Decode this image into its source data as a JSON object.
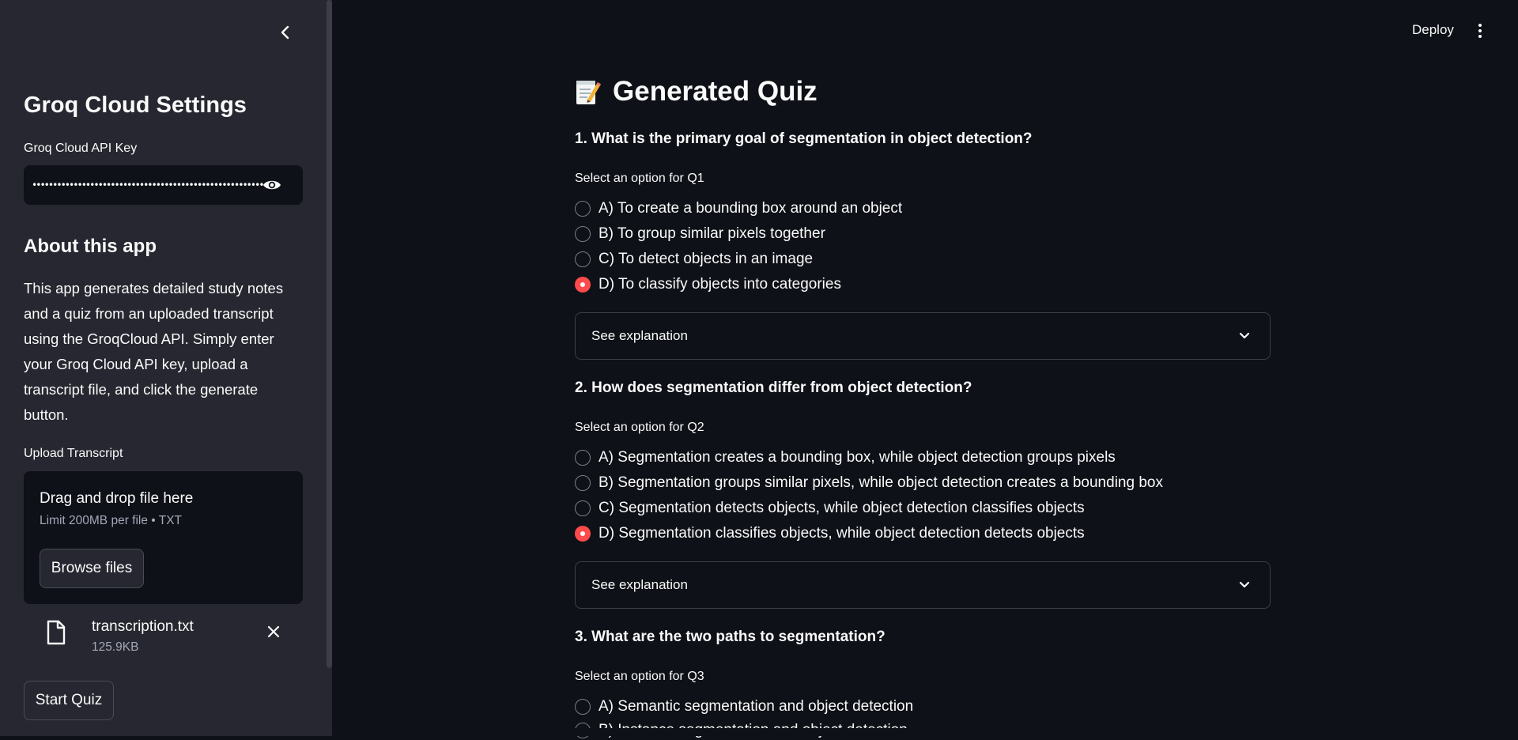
{
  "sidebar": {
    "title": "Groq Cloud Settings",
    "api_key_label": "Groq Cloud API Key",
    "api_key_value": "••••••••••••••••••••••••••••••••••••••••••••••••••••••••",
    "about_title": "About this app",
    "about_text": "This app generates detailed study notes and a quiz from an uploaded transcript using the GroqCloud API. Simply enter your Groq Cloud API key, upload a transcript file, and click the generate button.",
    "upload_label": "Upload Transcript",
    "dropzone_title": "Drag and drop file here",
    "dropzone_limit": "Limit 200MB per file • TXT",
    "browse_label": "Browse files",
    "file_name": "transcription.txt",
    "file_size": "125.9KB",
    "start_quiz_label": "Start Quiz"
  },
  "header": {
    "deploy_label": "Deploy"
  },
  "main": {
    "title": "Generated Quiz",
    "explanation_label": "See explanation",
    "questions": [
      {
        "question": "1. What is the primary goal of segmentation in object detection?",
        "select_label": "Select an option for Q1",
        "options": [
          "A) To create a bounding box around an object",
          "B) To group similar pixels together",
          "C) To detect objects in an image",
          "D) To classify objects into categories"
        ],
        "selected": "D"
      },
      {
        "question": "2. How does segmentation differ from object detection?",
        "select_label": "Select an option for Q2",
        "options": [
          "A) Segmentation creates a bounding box, while object detection groups pixels",
          "B) Segmentation groups similar pixels, while object detection creates a bounding box",
          "C) Segmentation detects objects, while object detection classifies objects",
          "D) Segmentation classifies objects, while object detection detects objects"
        ],
        "selected": "D"
      },
      {
        "question": "3. What are the two paths to segmentation?",
        "select_label": "Select an option for Q3",
        "options": [
          "A) Semantic segmentation and object detection",
          "B) Instance segmentation and object detection"
        ]
      }
    ]
  }
}
